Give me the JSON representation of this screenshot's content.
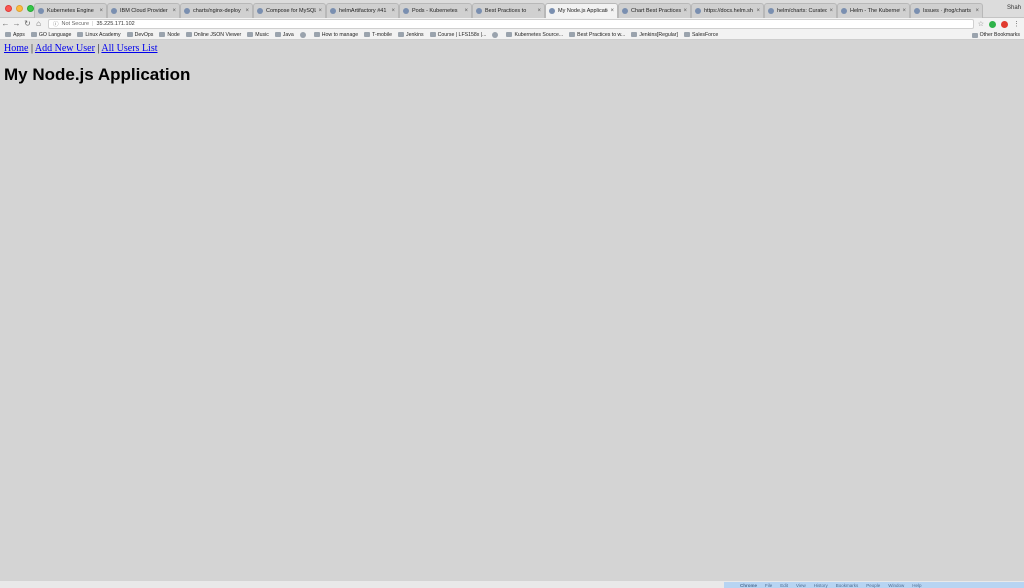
{
  "browser": {
    "tabs": [
      {
        "title": "Kubernetes Engine"
      },
      {
        "title": "IBM Cloud Provider"
      },
      {
        "title": "charts/nginx-deploy"
      },
      {
        "title": "Compose for MySQL"
      },
      {
        "title": "helmArtifactory #41"
      },
      {
        "title": "Pods - Kubernetes"
      },
      {
        "title": "Best Practices to"
      },
      {
        "title": "My Node.js Applicatio",
        "active": true
      },
      {
        "title": "Chart Best Practices"
      },
      {
        "title": "https://docs.helm.sh"
      },
      {
        "title": "helm/charts: Curated"
      },
      {
        "title": "Helm - The Kubernet"
      },
      {
        "title": "Issues · jfrog/charts"
      }
    ],
    "profile_name": "Shah",
    "address": {
      "security_label": "Not Secure",
      "url": "35.225.171.102"
    },
    "bookmarks": [
      {
        "label": "Apps"
      },
      {
        "label": "GO Language"
      },
      {
        "label": "Linux Academy"
      },
      {
        "label": "DevOps"
      },
      {
        "label": "Node"
      },
      {
        "label": "Online JSON Viewer"
      },
      {
        "label": "Music"
      },
      {
        "label": "Java"
      },
      {
        "label": ""
      },
      {
        "label": "How to manage"
      },
      {
        "label": "T-mobile"
      },
      {
        "label": "Jenkins"
      },
      {
        "label": "Course | LFS158x |..."
      },
      {
        "label": ""
      },
      {
        "label": "Kubernetes Source..."
      },
      {
        "label": "Best Practices to w..."
      },
      {
        "label": "Jenkins[Regular]"
      },
      {
        "label": "SalesForce"
      }
    ],
    "other_bookmarks": "Other Bookmarks"
  },
  "page": {
    "nav": {
      "home": "Home",
      "add_user": "Add New User",
      "all_users": "All Users List",
      "separator": "|"
    },
    "heading": "My Node.js Application"
  },
  "menubar": {
    "apple": "",
    "items": [
      "Chrome",
      "File",
      "Edit",
      "View",
      "History",
      "Bookmarks",
      "People",
      "Window",
      "Help"
    ]
  }
}
